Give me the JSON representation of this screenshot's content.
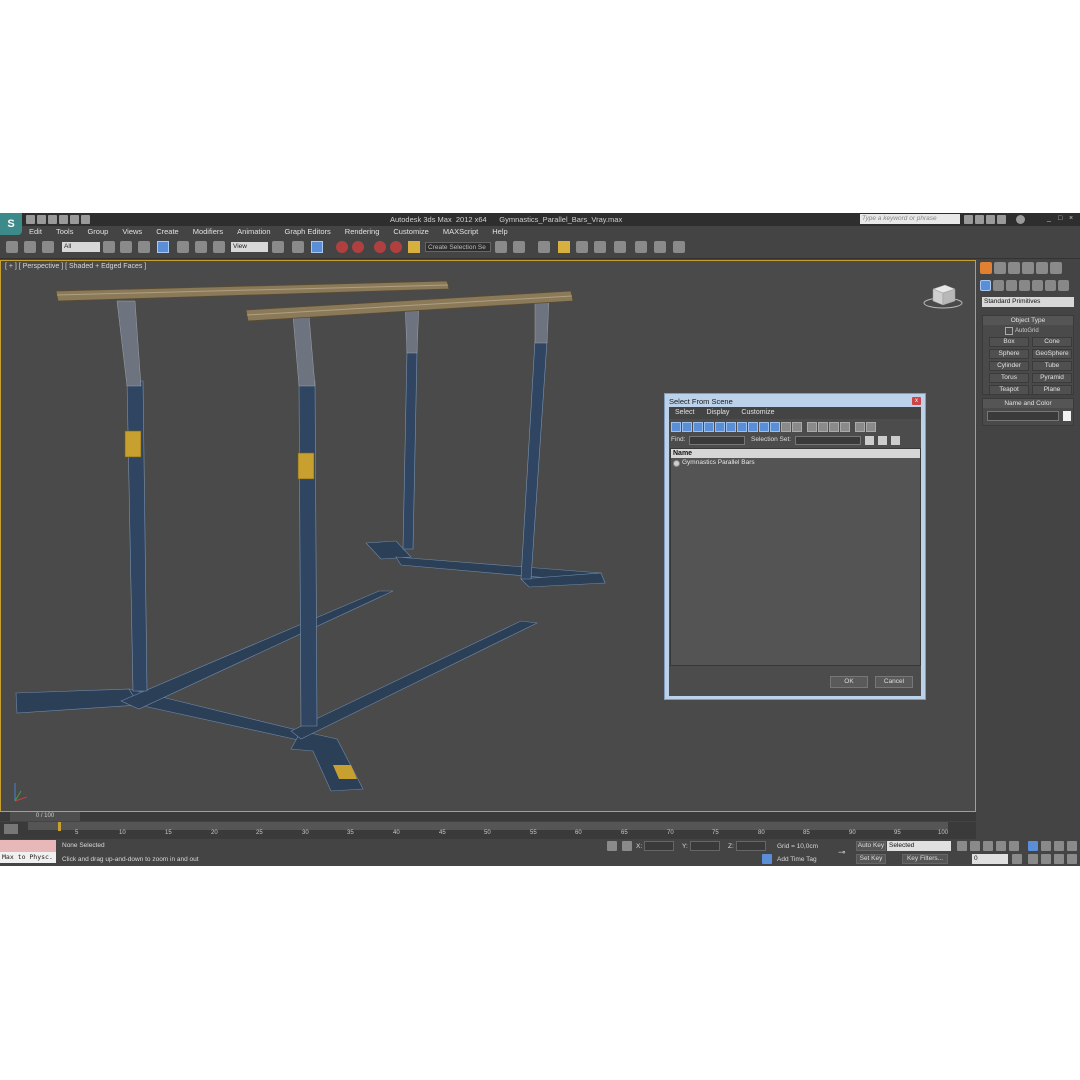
{
  "title_bar": {
    "app_title": "Autodesk 3ds Max  2012 x64",
    "file_name": "Gymnastics_Parallel_Bars_Vray.max",
    "search_placeholder": "Type a keyword or phrase"
  },
  "menu": [
    "Edit",
    "Tools",
    "Group",
    "Views",
    "Create",
    "Modifiers",
    "Animation",
    "Graph Editors",
    "Rendering",
    "Customize",
    "MAXScript",
    "Help"
  ],
  "toolbar": {
    "selection_filter": "All",
    "reference_coord": "View",
    "named_selection_placeholder": "Create Selection Se"
  },
  "viewport": {
    "label": "[ + ] [ Perspective ] [ Shaded + Edged Faces ]"
  },
  "dialog": {
    "title": "Select From Scene",
    "close": "x",
    "menu": [
      "Select",
      "Display",
      "Customize"
    ],
    "find_label": "Find:",
    "selection_set_label": "Selection Set:",
    "column_header": "Name",
    "items": [
      "Gymnastics Parallel Bars"
    ],
    "ok": "OK",
    "cancel": "Cancel"
  },
  "command_panel": {
    "category": "Standard Primitives",
    "object_type_title": "Object Type",
    "autogrid": "AutoGrid",
    "primitives": [
      "Box",
      "Cone",
      "Sphere",
      "GeoSphere",
      "Cylinder",
      "Tube",
      "Torus",
      "Pyramid",
      "Teapot",
      "Plane"
    ],
    "name_color_title": "Name and Color"
  },
  "timeline": {
    "frame_display": "0 / 100",
    "tick_labels": [
      "5",
      "10",
      "15",
      "20",
      "25",
      "30",
      "35",
      "40",
      "45",
      "50",
      "55",
      "60",
      "65",
      "70",
      "75",
      "80",
      "85",
      "90",
      "95",
      "100"
    ]
  },
  "status": {
    "maxscript_text": "Max to Physc.",
    "selection": "None Selected",
    "prompt": "Click and drag up-and-down to zoom in and out",
    "x_label": "X:",
    "y_label": "Y:",
    "z_label": "Z:",
    "grid": "Grid = 10,0cm",
    "add_time_tag": "Add Time Tag",
    "auto_key": "Auto Key",
    "set_key": "Set Key",
    "key_mode": "Selected",
    "key_filters": "Key Filters...",
    "current_frame": "0"
  },
  "colors": {
    "viewport_border": "#c8a030",
    "dialog_frame": "#bcd2ea",
    "wireframe": "#253a52",
    "bar_rail": "#8a7a5a"
  }
}
